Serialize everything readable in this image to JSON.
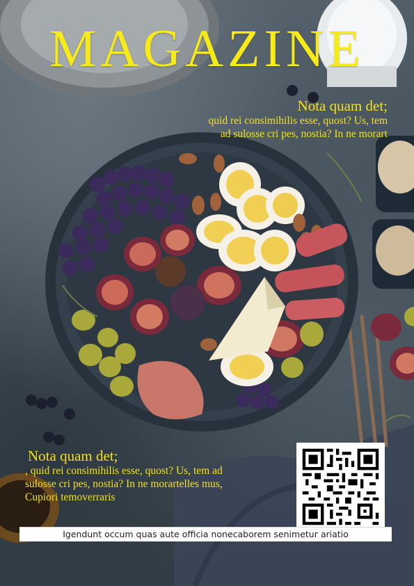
{
  "cover": {
    "masthead": "MAGAZINE",
    "teaser_top": {
      "head": "Nota quam det;",
      "body": "quid rei consimihilis esse, quost? Us, tem ad sulosse cri pes, nostia? In ne morart"
    },
    "teaser_bottom": {
      "head": "Nota quam det;",
      "body": ", quid rei consimihilis esse, quost? Us, tem ad sulosse cri pes, nostia? In ne morartelles mus, Cupiori temoverraris"
    },
    "footer": "Igendunt occum quas aute officia nonecaborem senimetur ariatio"
  },
  "colors": {
    "masthead": "#f6ea1a",
    "teaser_text": "#f4e21c",
    "background": "#46525b"
  }
}
